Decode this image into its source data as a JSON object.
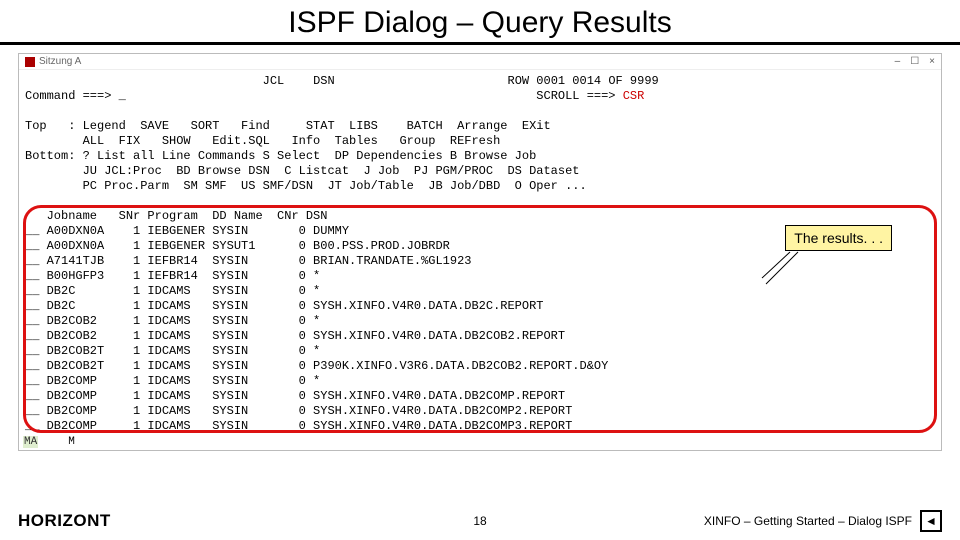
{
  "slide": {
    "title": "ISPF Dialog – Query Results",
    "page_number": "18",
    "brand": "HORIZONT",
    "footer_right": "XINFO – Getting Started – Dialog ISPF"
  },
  "callout": {
    "text": "The results. . ."
  },
  "window": {
    "session_label": "Sitzung A",
    "controls": {
      "min": "–",
      "max": "☐",
      "close": "×"
    },
    "status_left": "MA",
    "status_right": "M"
  },
  "ispf": {
    "header_labels": {
      "jcl": "JCL",
      "dsn": "DSN"
    },
    "row_info": "ROW 0001 0014 OF 9999",
    "command_prompt": "Command ===> _",
    "scroll_label": "SCROLL ===> ",
    "scroll_value": "CSR",
    "top_line1": "Top   : Legend  SAVE   SORT   Find     STAT  LIBS    BATCH  Arrange  EXit",
    "top_line2": "        ALL  FIX   SHOW   Edit.SQL   Info  Tables   Group  REFresh",
    "bottom_line1": "Bottom: ? List all Line Commands S Select  DP Dependencies B Browse Job",
    "bottom_line2": "        JU JCL:Proc  BD Browse DSN  C Listcat  J Job  PJ PGM/PROC  DS Dataset",
    "bottom_line3": "        PC Proc.Parm  SM SMF  US SMF/DSN  JT Job/Table  JB Job/DBD  O Oper ...",
    "columns": "   Jobname   SNr Program  DD Name  CNr DSN",
    "rows": [
      "__ A00DXN0A    1 IEBGENER SYSIN       0 DUMMY",
      "__ A00DXN0A    1 IEBGENER SYSUT1      0 B00.PSS.PROD.JOBRDR",
      "__ A7141TJB    1 IEFBR14  SYSIN       0 BRIAN.TRANDATE.%GL1923",
      "__ B00HGFP3    1 IEFBR14  SYSIN       0 *",
      "__ DB2C        1 IDCAMS   SYSIN       0 *",
      "__ DB2C        1 IDCAMS   SYSIN       0 SYSH.XINFO.V4R0.DATA.DB2C.REPORT",
      "__ DB2COB2     1 IDCAMS   SYSIN       0 *",
      "__ DB2COB2     1 IDCAMS   SYSIN       0 SYSH.XINFO.V4R0.DATA.DB2COB2.REPORT",
      "__ DB2COB2T    1 IDCAMS   SYSIN       0 *",
      "__ DB2COB2T    1 IDCAMS   SYSIN       0 P390K.XINFO.V3R6.DATA.DB2COB2.REPORT.D&OY",
      "__ DB2COMP     1 IDCAMS   SYSIN       0 *",
      "__ DB2COMP     1 IDCAMS   SYSIN       0 SYSH.XINFO.V4R0.DATA.DB2COMP.REPORT",
      "__ DB2COMP     1 IDCAMS   SYSIN       0 SYSH.XINFO.V4R0.DATA.DB2COMP2.REPORT",
      "__ DB2COMP     1 IDCAMS   SYSIN       0 SYSH.XINFO.V4R0.DATA.DB2COMP3.REPORT"
    ]
  }
}
